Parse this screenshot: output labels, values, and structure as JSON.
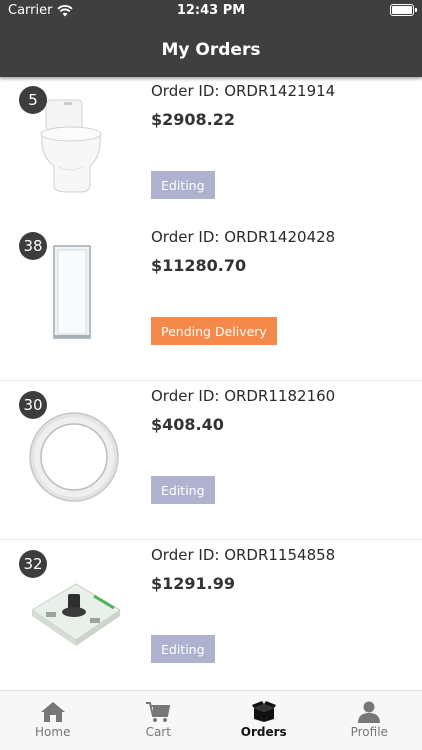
{
  "status_bar": {
    "carrier": "Carrier",
    "time": "12:43 PM"
  },
  "nav": {
    "title": "My Orders"
  },
  "orders": [
    {
      "qty": "5",
      "order_id": "Order ID: ORDR1421914",
      "price": "$2908.22",
      "status": "Editing"
    },
    {
      "qty": "38",
      "order_id": "Order ID: ORDR1420428",
      "price": "$11280.70",
      "status": "Pending Delivery"
    },
    {
      "qty": "30",
      "order_id": "Order ID: ORDR1182160",
      "price": "$408.40",
      "status": "Editing"
    },
    {
      "qty": "32",
      "order_id": "Order ID: ORDR1154858",
      "price": "$1291.99",
      "status": "Editing"
    }
  ],
  "tabs": [
    {
      "label": "Home",
      "icon": "home-icon"
    },
    {
      "label": "Cart",
      "icon": "cart-icon"
    },
    {
      "label": "Orders",
      "icon": "box-icon"
    },
    {
      "label": "Profile",
      "icon": "profile-icon"
    }
  ],
  "colors": {
    "header": "#3f3f3f",
    "editing_badge": "#aeb2cf",
    "pending_badge": "#f4894a",
    "qty_badge": "#3d3d3d"
  }
}
